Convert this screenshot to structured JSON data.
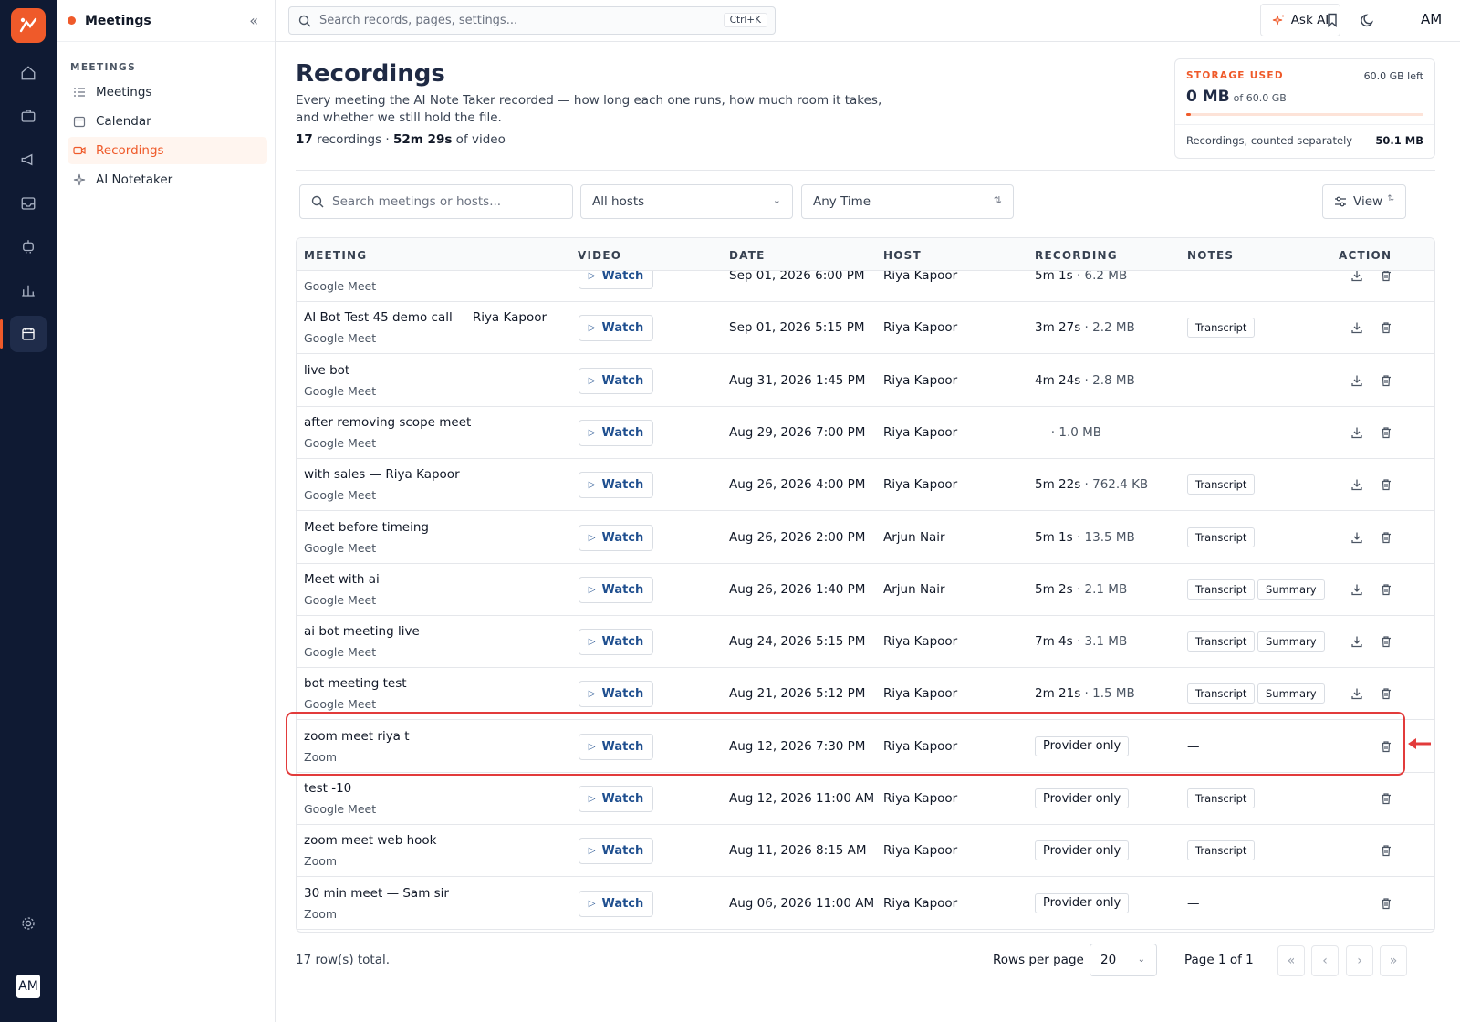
{
  "app": {
    "section_title": "Meetings",
    "nav_section": "MEETINGS",
    "nav_items": [
      {
        "label": "Meetings",
        "icon": "list-icon"
      },
      {
        "label": "Calendar",
        "icon": "calendar-icon"
      },
      {
        "label": "Recordings",
        "icon": "video-icon",
        "active": true
      },
      {
        "label": "AI Notetaker",
        "icon": "sparkle-icon"
      }
    ],
    "user_initials": "AM"
  },
  "topbar": {
    "search_placeholder": "Search records, pages, settings...",
    "search_shortcut": "Ctrl+K",
    "ask_ai_label": "Ask AI",
    "user_initials": "AM"
  },
  "page": {
    "title": "Recordings",
    "description": "Every meeting the AI Note Taker recorded — how long each one runs, how much room it takes, and whether we still hold the file.",
    "count_bold": "17",
    "count_text": " recordings · ",
    "duration_bold": "52m 29s",
    "duration_text": " of video"
  },
  "storage": {
    "label": "STORAGE USED",
    "left_text": "60.0 GB left",
    "used": "0 MB",
    "of_total": "of 60.0 GB",
    "used_fraction": 0.01,
    "recordings_label": "Recordings, counted separately",
    "recordings_value": "50.1 MB"
  },
  "filters": {
    "search_placeholder": "Search meetings or hosts...",
    "host_value": "All hosts",
    "time_value": "Any Time",
    "view_label": "View"
  },
  "table": {
    "headers": [
      "MEETING",
      "VIDEO",
      "DATE",
      "HOST",
      "RECORDING",
      "NOTES",
      "ACTION"
    ],
    "watch_label": "Watch",
    "rows": [
      {
        "title": "",
        "provider": "Google Meet",
        "date": "Sep 01, 2026 6:00 PM",
        "host": "Riya Kapoor",
        "duration": "5m 1s",
        "size": "6.2 MB",
        "recording_badge": "",
        "notes": [],
        "download": true
      },
      {
        "title": "AI Bot Test 45 demo call — Riya Kapoor",
        "provider": "Google Meet",
        "date": "Sep 01, 2026 5:15 PM",
        "host": "Riya Kapoor",
        "duration": "3m 27s",
        "size": "2.2 MB",
        "recording_badge": "",
        "notes": [
          "Transcript"
        ],
        "download": true
      },
      {
        "title": "live bot",
        "provider": "Google Meet",
        "date": "Aug 31, 2026 1:45 PM",
        "host": "Riya Kapoor",
        "duration": "4m 24s",
        "size": "2.8 MB",
        "recording_badge": "",
        "notes": [],
        "download": true
      },
      {
        "title": "after removing scope meet",
        "provider": "Google Meet",
        "date": "Aug 29, 2026 7:00 PM",
        "host": "Riya Kapoor",
        "duration": "—",
        "size": "1.0 MB",
        "recording_badge": "",
        "notes": [],
        "download": true
      },
      {
        "title": "with sales — Riya Kapoor",
        "provider": "Google Meet",
        "date": "Aug 26, 2026 4:00 PM",
        "host": "Riya Kapoor",
        "duration": "5m 22s",
        "size": "762.4 KB",
        "recording_badge": "",
        "notes": [
          "Transcript"
        ],
        "download": true
      },
      {
        "title": "Meet before timeing",
        "provider": "Google Meet",
        "date": "Aug 26, 2026 2:00 PM",
        "host": "Arjun Nair",
        "duration": "5m 1s",
        "size": "13.5 MB",
        "recording_badge": "",
        "notes": [
          "Transcript"
        ],
        "download": true
      },
      {
        "title": "Meet with ai",
        "provider": "Google Meet",
        "date": "Aug 26, 2026 1:40 PM",
        "host": "Arjun Nair",
        "duration": "5m 2s",
        "size": "2.1 MB",
        "recording_badge": "",
        "notes": [
          "Transcript",
          "Summary"
        ],
        "download": true
      },
      {
        "title": "ai bot meeting live",
        "provider": "Google Meet",
        "date": "Aug 24, 2026 5:15 PM",
        "host": "Riya Kapoor",
        "duration": "7m 4s",
        "size": "3.1 MB",
        "recording_badge": "",
        "notes": [
          "Transcript",
          "Summary"
        ],
        "download": true
      },
      {
        "title": "bot meeting test",
        "provider": "Google Meet",
        "date": "Aug 21, 2026 5:12 PM",
        "host": "Riya Kapoor",
        "duration": "2m 21s",
        "size": "1.5 MB",
        "recording_badge": "",
        "notes": [
          "Transcript",
          "Summary"
        ],
        "download": true
      },
      {
        "title": "zoom meet riya t",
        "provider": "Zoom",
        "date": "Aug 12, 2026 7:30 PM",
        "host": "Riya Kapoor",
        "duration": "",
        "size": "",
        "recording_badge": "Provider only",
        "notes": [],
        "download": false
      },
      {
        "title": "test -10",
        "provider": "Google Meet",
        "date": "Aug 12, 2026 11:00 AM",
        "host": "Riya Kapoor",
        "duration": "",
        "size": "",
        "recording_badge": "Provider only",
        "notes": [
          "Transcript"
        ],
        "download": false
      },
      {
        "title": "zoom meet web hook",
        "provider": "Zoom",
        "date": "Aug 11, 2026 8:15 AM",
        "host": "Riya Kapoor",
        "duration": "",
        "size": "",
        "recording_badge": "Provider only",
        "notes": [
          "Transcript"
        ],
        "download": false
      },
      {
        "title": "30 min meet — Sam sir",
        "provider": "Zoom",
        "date": "Aug 06, 2026 11:00 AM",
        "host": "Riya Kapoor",
        "duration": "",
        "size": "",
        "recording_badge": "Provider only",
        "notes": [],
        "download": false
      }
    ],
    "empty_note": "—"
  },
  "footer": {
    "total": "17 row(s) total.",
    "rows_per_page_label": "Rows per page",
    "rows_per_page_value": "20",
    "page_info": "Page 1 of 1"
  },
  "colors": {
    "accent": "#ef5a2a",
    "rail": "#0f1a33",
    "highlight": "#e23b3b",
    "watch": "#1f4f8f"
  }
}
